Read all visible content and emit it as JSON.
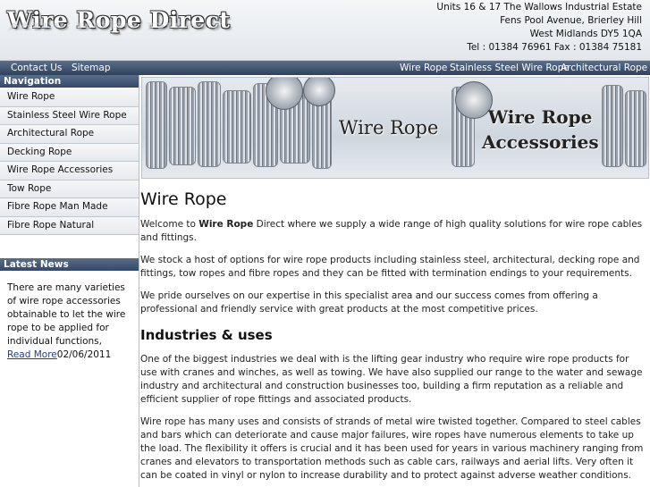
{
  "header": {
    "logo_text": "Wire Rope Direct",
    "address": [
      "Units 16 & 17 The Wallows Industrial Estate",
      "Fens Pool Avenue, Brierley Hill",
      "West Midlands DY5 1QA",
      "Tel : 01384 76961 Fax : 01384 75181"
    ]
  },
  "topbar": {
    "contact": "Contact Us",
    "sitemap": "Sitemap",
    "right_links": [
      "Wire Rope",
      "Stainless Steel Wire Rope",
      "Architectural Rope"
    ]
  },
  "sidebar": {
    "nav_title": "Navigation",
    "items": [
      "Wire Rope",
      "Stainless Steel Wire Rope",
      "Architectural Rope",
      "Decking Rope",
      "Wire Rope Accessories",
      "Tow Rope",
      "Fibre Rope Man Made",
      "Fibre Rope Natural"
    ],
    "news_title": "Latest News",
    "news_text": "There are many varieties of wire rope accessories obtainable to let the wire rope to be applied for individual functions,",
    "news_link": "Read More",
    "news_date": "02/06/2011"
  },
  "banner": {
    "left_text": "Wire Rope",
    "right_text_1": "Wire Rope",
    "right_text_2": "Accessories"
  },
  "main": {
    "title": "Wire Rope",
    "intro_pre": "Welcome to ",
    "intro_bold": "Wire Rope",
    "intro_post": " Direct where we supply a wide range of high quality solutions for wire rope cables and fittings.",
    "p2": "We stock a host of options for wire rope products including stainless steel, architectural, decking rope and fittings, tow ropes and fibre ropes and they can be fitted with termination endings to your requirements.",
    "p3": "We pride ourselves on our expertise in this specialist area and our success comes from offering a professional and friendly service with great products at the most competitive prices.",
    "h2": "Industries & uses",
    "p4": "One of the biggest industries we deal with is the lifting gear industry who require wire rope products for use with cranes and winches, as well as towing. We have also supplied our range to the water and sewage industry and architectural and construction businesses too, building a firm reputation as a reliable and efficient supplier of rope fittings and associated products.",
    "p5": "Wire rope has many uses and consists of strands of metal wire twisted together. Compared to steel cables and bars which can deteriorate and cause major failures, wire ropes have numerous elements to take up the load. The flexibility it offers is crucial and it has been used for years in various machinery ranging from cranes and elevators to transportation methods such as cable cars, railways and aerial lifts. Very often it can be coated in vinyl or nylon to increase durability and to protect against adverse weather conditions."
  }
}
